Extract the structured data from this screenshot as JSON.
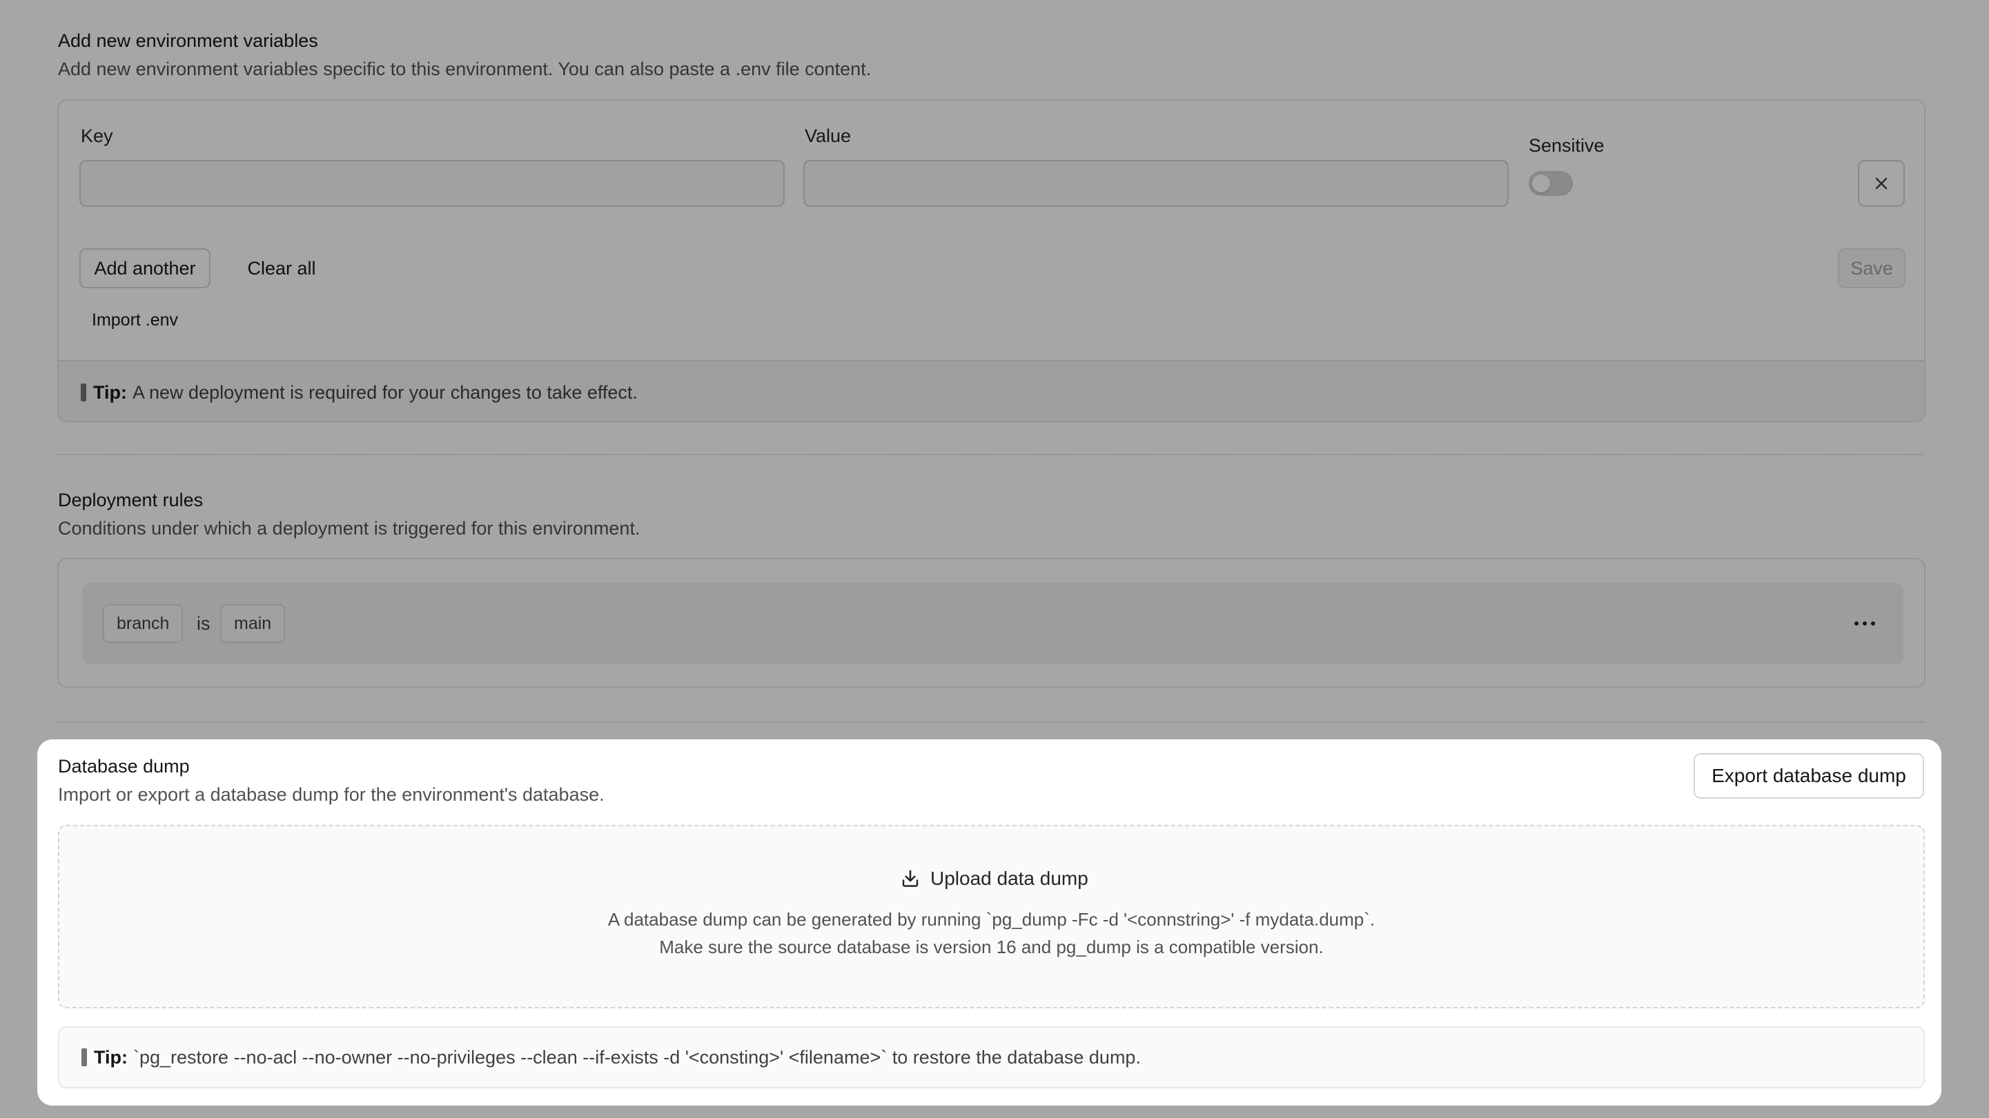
{
  "env_vars": {
    "title": "Add new environment variables",
    "description": "Add new environment variables specific to this environment. You can also paste a .env file content.",
    "key_label": "Key",
    "value_label": "Value",
    "sensitive_label": "Sensitive",
    "key_value": "",
    "value_value": "",
    "sensitive_on": false,
    "remove_icon": "close-icon",
    "add_another_label": "Add another",
    "clear_all_label": "Clear all",
    "save_label": "Save",
    "import_label": "Import .env",
    "tip_label": "Tip:",
    "tip_text": "A new deployment is required for your changes to take effect."
  },
  "deployment_rules": {
    "title": "Deployment rules",
    "description": "Conditions under which a deployment is triggered for this environment.",
    "rule": {
      "field": "branch",
      "operator": "is",
      "value": "main"
    },
    "menu_icon": "more-horizontal-icon"
  },
  "database_dump": {
    "title": "Database dump",
    "description": "Import or export a database dump for the environment's database.",
    "export_label": "Export database dump",
    "upload_icon": "download-tray-icon",
    "upload_label": "Upload data dump",
    "hint_line1": "A database dump can be generated by running `pg_dump -Fc -d '<connstring>' -f mydata.dump`.",
    "hint_line2": "Make sure the source database is version 16 and pg_dump is a compatible version.",
    "tip_label": "Tip:",
    "tip_text": "`pg_restore --no-acl --no-owner --no-privileges --clean --if-exists -d '<consting>' <filename>` to restore the database dump."
  },
  "colors": {
    "overlay": "#000000",
    "panel": "#ffffff",
    "text_primary": "#171717",
    "text_secondary": "#525252",
    "border": "#d4d4d4"
  }
}
